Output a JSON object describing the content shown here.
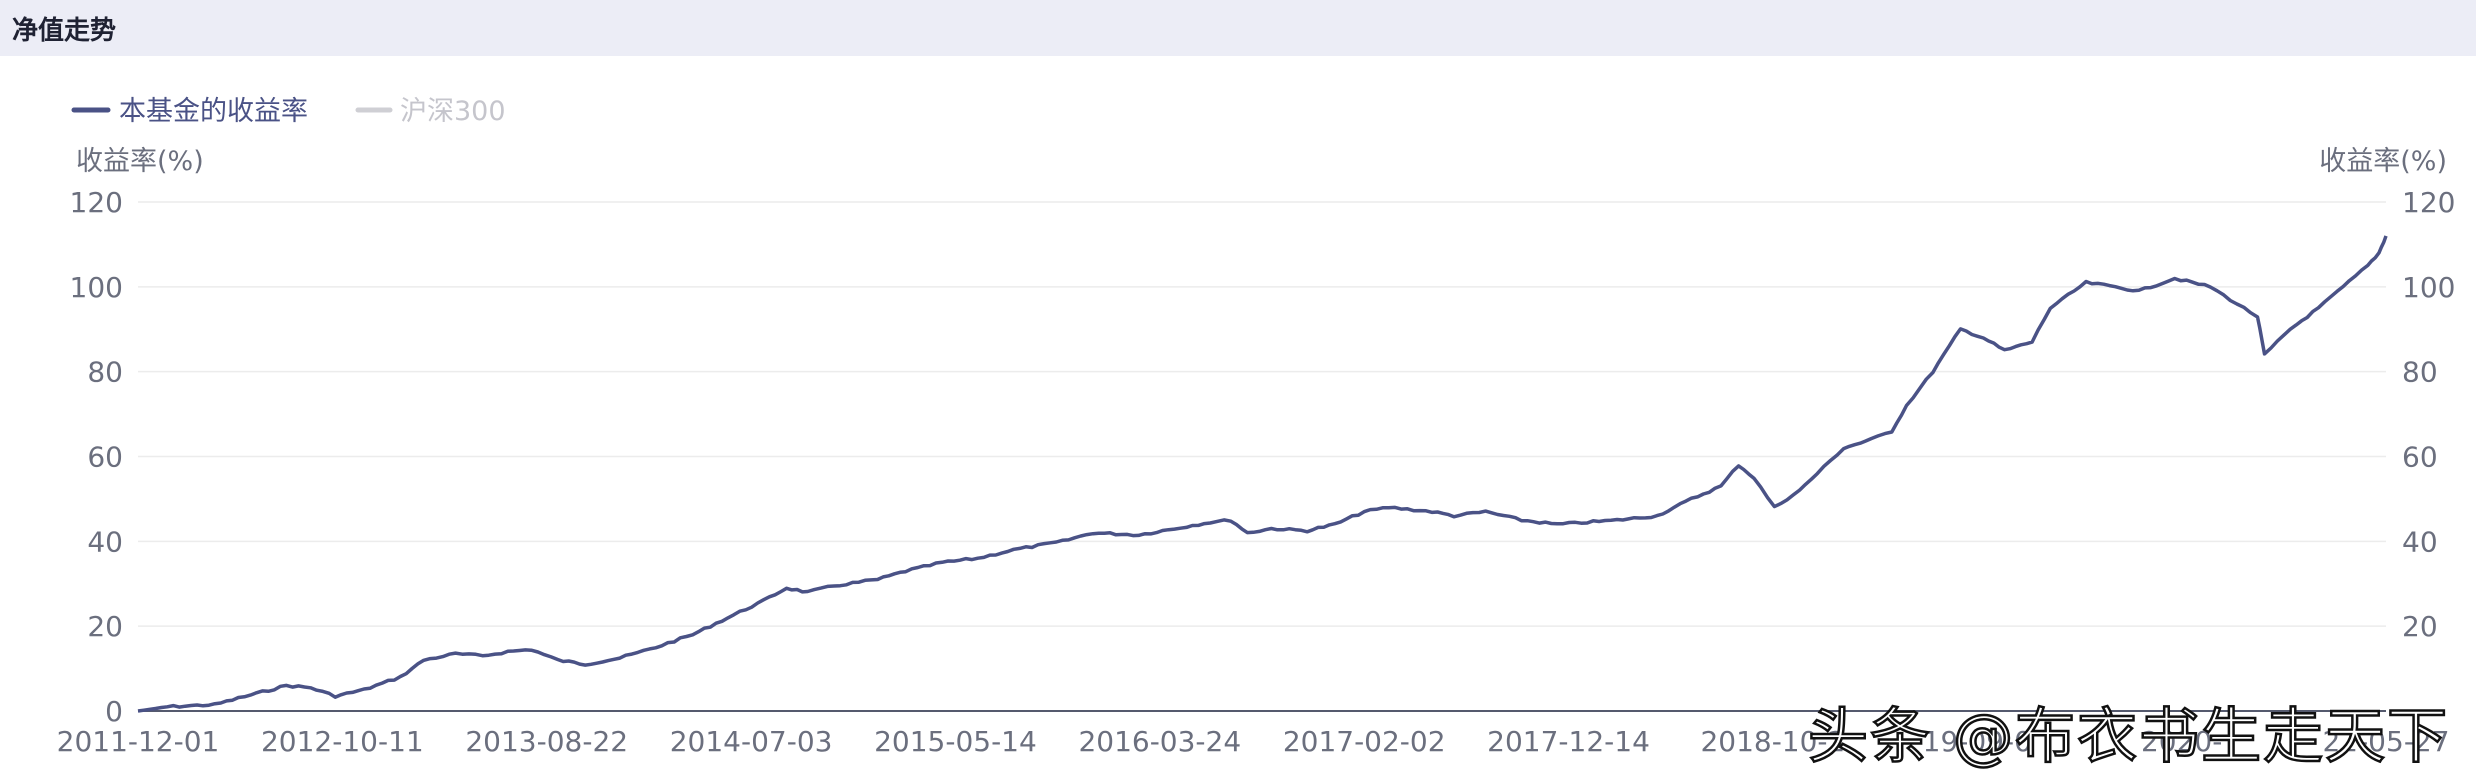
{
  "header": {
    "title": "净值走势"
  },
  "watermark": "头条 @布衣书生走天下",
  "colors": {
    "fund_line": "#4a5286",
    "index_line": "#cfcfd4",
    "grid": "#ececec",
    "header_bg": "#ecedf6"
  },
  "chart_data": {
    "type": "line",
    "x_axis": {
      "ticks": [
        "2011-12-01",
        "2012-10-11",
        "2013-08-22",
        "2014-07-03",
        "2015-05-14",
        "2016-03-24",
        "2017-02-02",
        "2017-12-14",
        "2018-10-2",
        "19-09-0",
        "2020-",
        "22-05-27"
      ]
    },
    "y_axis_left": {
      "label": "收益率(%)",
      "ticks": [
        "120",
        "100",
        "80",
        "60",
        "40",
        "20",
        "0"
      ],
      "range": [
        0,
        120
      ]
    },
    "y_axis_right": {
      "label": "收益率(%)",
      "ticks": [
        "120",
        "100",
        "80",
        "60",
        "40",
        "20"
      ],
      "range": [
        0,
        120
      ]
    },
    "grid": true,
    "legend": {
      "position": "top-left"
    },
    "series": [
      {
        "name": "本基金的收益率",
        "active": true,
        "x": [
          "2011-12-01",
          "2012-01-20",
          "2012-04-10",
          "2012-05-20",
          "2012-08-10",
          "2012-09-20",
          "2012-11-01",
          "2012-12-20",
          "2013-02-20",
          "2013-04-01",
          "2013-05-25",
          "2013-07-10",
          "2013-08-22",
          "2013-10-01",
          "2013-11-15",
          "2014-01-01",
          "2014-03-01",
          "2014-05-01",
          "2014-07-03",
          "2014-09-01",
          "2014-11-01",
          "2014-12-10",
          "2015-01-15",
          "2015-03-01",
          "2015-05-14",
          "2015-07-01",
          "2015-09-01",
          "2015-11-01",
          "2016-01-01",
          "2016-03-24",
          "2016-05-15",
          "2016-08-01",
          "2016-10-01",
          "2016-12-01",
          "2017-01-05",
          "2017-02-02",
          "2017-03-15",
          "2017-05-15",
          "2017-07-01",
          "2017-08-20",
          "2017-10-01",
          "2017-12-14",
          "2018-01-20",
          "2018-03-15",
          "2018-05-15",
          "2018-07-15",
          "2018-10-25",
          "2019-01-01",
          "2019-03-01",
          "2019-04-20",
          "2019-05-20",
          "2019-06-15",
          "2019-07-20",
          "2019-09-01",
          "2019-10-01",
          "2019-11-15",
          "2020-01-01",
          "2020-02-05",
          "2020-03-01",
          "2020-04-15",
          "2020-06-01",
          "2020-07-10",
          "2020-08-15",
          "2020-10-01",
          "2020-11-01",
          "2021-01-01",
          "2021-02-20",
          "2021-04-01",
          "2021-06-01",
          "2021-08-01",
          "2021-09-15",
          "2021-10-20",
          "2021-11-01",
          "2021-12-15",
          "2022-02-01",
          "2022-03-15",
          "2022-04-26",
          "2022-05-15",
          "2022-05-27"
        ],
        "y": [
          0,
          1,
          1.5,
          3,
          6,
          5.5,
          3.5,
          5,
          8,
          12,
          13.5,
          13,
          14,
          14.5,
          12,
          11,
          12.5,
          15,
          18,
          22,
          26,
          29,
          28,
          29.5,
          31,
          33,
          35,
          36,
          38,
          40,
          42,
          41.5,
          43,
          44.5,
          45,
          42,
          43,
          42.5,
          44,
          47,
          48,
          47,
          46,
          47,
          45,
          44,
          45,
          46,
          50,
          53,
          58,
          55,
          48,
          52,
          56,
          62,
          64,
          66,
          72,
          80,
          90,
          88,
          85,
          87,
          95,
          101,
          100,
          99,
          102,
          100,
          96,
          93,
          84,
          90,
          95,
          100,
          105,
          108,
          112
        ]
      },
      {
        "name": "沪深300",
        "active": false,
        "x": [],
        "y": []
      }
    ]
  }
}
